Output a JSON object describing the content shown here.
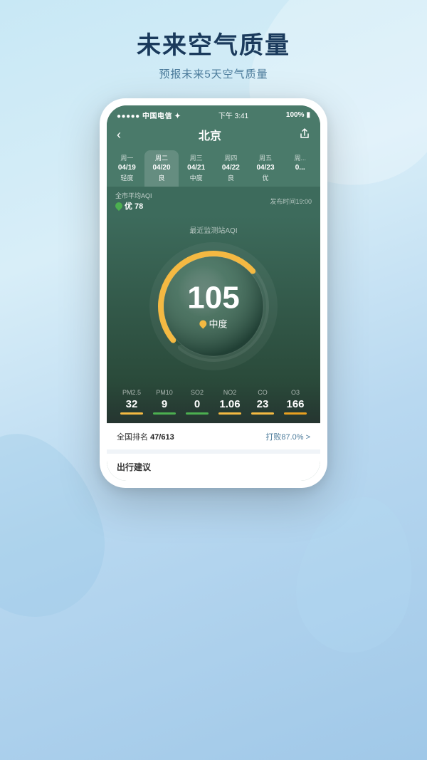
{
  "page": {
    "title": "未来空气质量",
    "subtitle": "预报未来5天空气质量"
  },
  "status_bar": {
    "left": "●●●●● 中国电信 ✦",
    "center": "下午 3:41",
    "right": "100%"
  },
  "nav": {
    "back_icon": "‹",
    "title": "北京",
    "share_icon": "⬆"
  },
  "days": [
    {
      "week": "周一",
      "date": "04/19",
      "quality": "轻度",
      "active": false
    },
    {
      "week": "周二",
      "date": "04/20",
      "quality": "良",
      "active": true
    },
    {
      "week": "周三",
      "date": "04/21",
      "quality": "中度",
      "active": false
    },
    {
      "week": "周四",
      "date": "04/22",
      "quality": "良",
      "active": false
    },
    {
      "week": "周五",
      "date": "04/23",
      "quality": "优",
      "active": false
    },
    {
      "week": "周...",
      "date": "0...",
      "quality": "",
      "active": false
    }
  ],
  "aqi_bar": {
    "city_avg_label": "全市平均AQI",
    "city_avg_value": "优 78",
    "publish_time": "发布时间19:00"
  },
  "gauge": {
    "label": "最近监测站AQI",
    "value": "105",
    "quality": "中度"
  },
  "metrics": [
    {
      "name": "PM2.5",
      "value": "32",
      "bar_color": "bar-yellow"
    },
    {
      "name": "PM10",
      "value": "9",
      "bar_color": "bar-green"
    },
    {
      "name": "SO2",
      "value": "0",
      "bar_color": "bar-green"
    },
    {
      "name": "NO2",
      "value": "1.06",
      "bar_color": "bar-yellow"
    },
    {
      "name": "CO",
      "value": "23",
      "bar_color": "bar-yellow"
    },
    {
      "name": "O3",
      "value": "166",
      "bar_color": "bar-orange"
    }
  ],
  "ranking": {
    "label": "全国排名",
    "rank": "47/613",
    "beat": "打败87.0%",
    "arrow": ">"
  },
  "advice": {
    "label": "出行建议"
  },
  "colors": {
    "accent": "#f4b942",
    "green": "#4caf50",
    "dark_bg": "#2a4a3a"
  }
}
